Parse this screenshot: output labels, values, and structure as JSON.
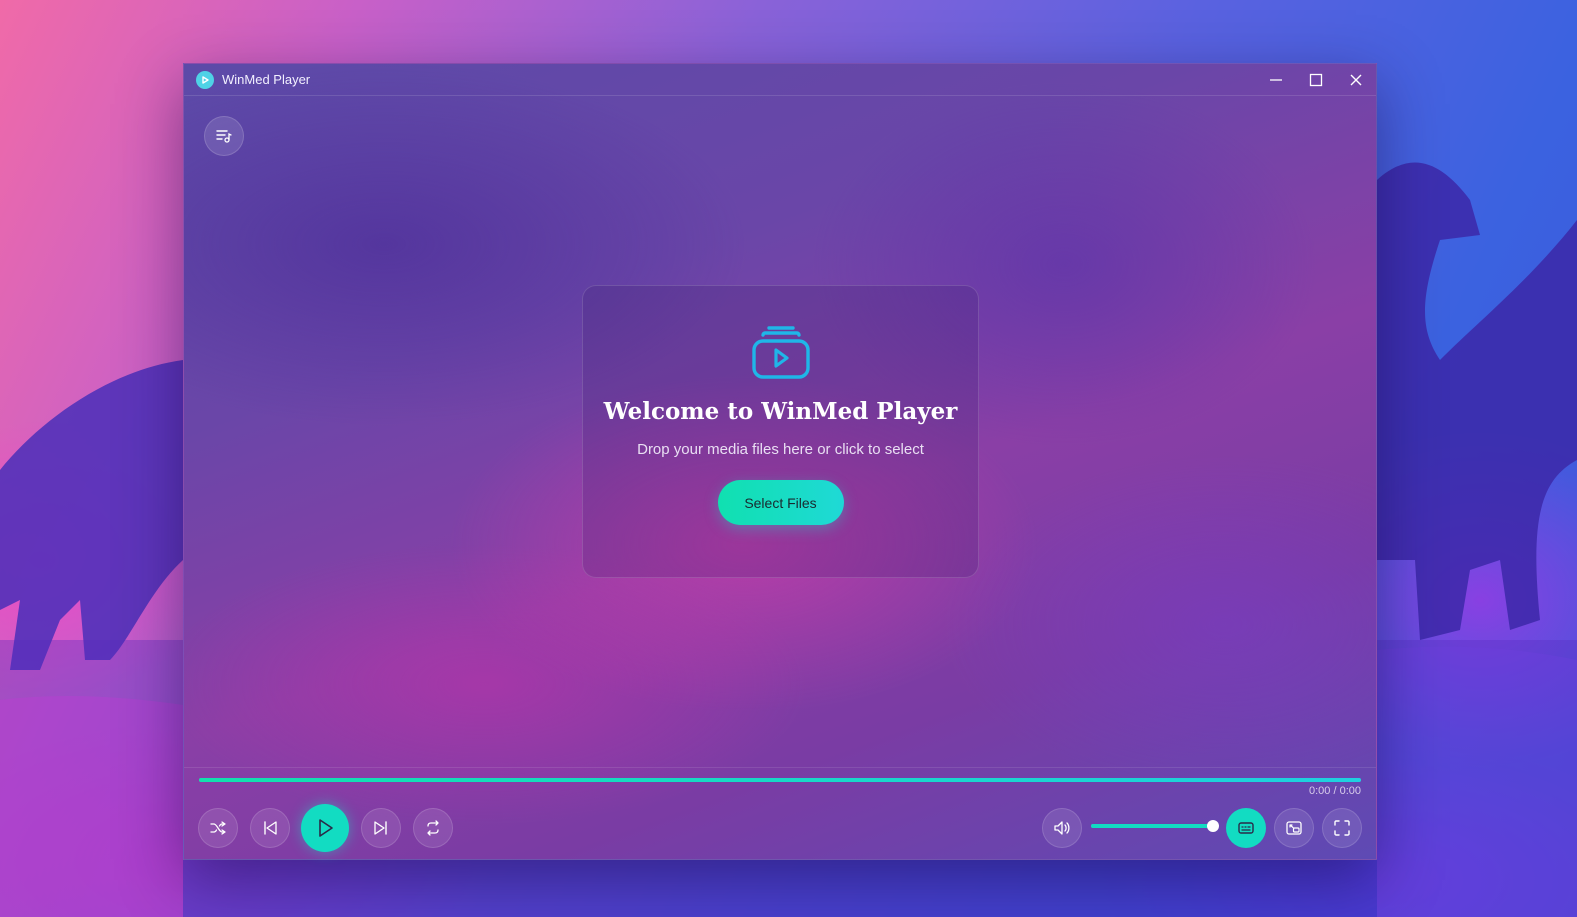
{
  "window": {
    "title": "WinMed Player"
  },
  "welcome": {
    "title": "Welcome to WinMed Player",
    "subtitle": "Drop your media files here or click to select",
    "select_button": "Select Files"
  },
  "playback": {
    "time": "0:00 / 0:00",
    "progress_fraction": 1.0,
    "volume_fraction": 1.0
  },
  "icons": {
    "app": "play-circle-icon",
    "playlist": "playlist-icon",
    "welcome": "media-stack-play-icon",
    "shuffle": "shuffle-icon",
    "previous": "skip-back-icon",
    "play": "play-icon",
    "next": "skip-forward-icon",
    "repeat": "repeat-icon",
    "volume": "volume-icon",
    "subtitles": "subtitles-icon",
    "picture_in_picture": "picture-in-picture-icon",
    "fullscreen": "fullscreen-icon"
  },
  "colors": {
    "accent": "#12dcc2",
    "welcome_icon": "#1fb6e8"
  }
}
